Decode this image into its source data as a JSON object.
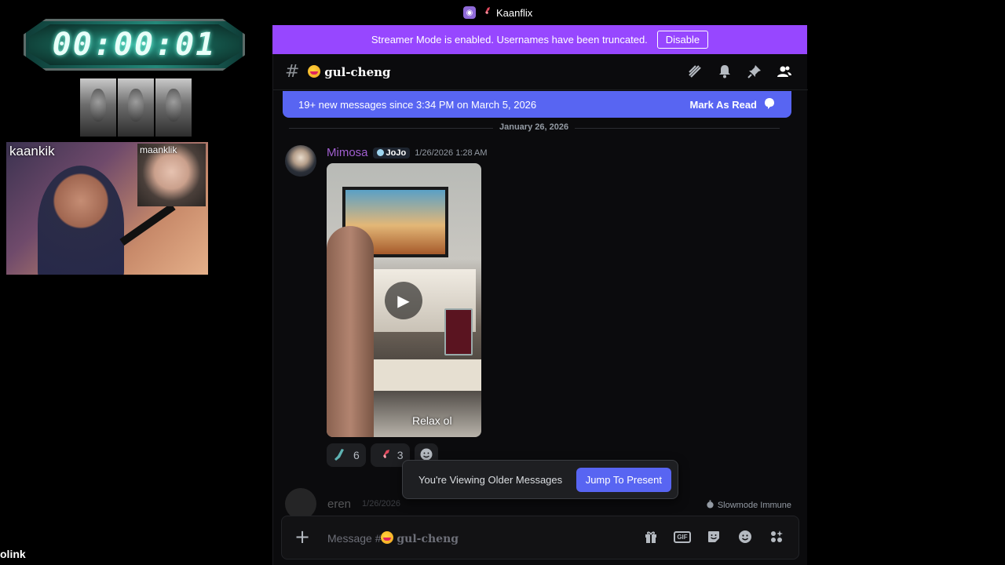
{
  "overlay": {
    "timer": "00:00:01",
    "cam_main_label": "kaankik",
    "cam_secondary_label": "maanklik",
    "bottom_left_text": "olink"
  },
  "window": {
    "title": "Kaanflix"
  },
  "streamer_banner": {
    "text": "Streamer Mode is enabled. Usernames have been truncated.",
    "button": "Disable"
  },
  "channel": {
    "name": "gul-cheng",
    "header_icons": [
      "threads-icon",
      "bell-icon",
      "pin-icon",
      "members-icon"
    ]
  },
  "new_messages_bar": {
    "text": "19+ new messages since 3:34 PM on March 5, 2026",
    "action": "Mark As Read"
  },
  "date_divider": "January 26, 2026",
  "message": {
    "author": "Mimosa",
    "role_tag": "JoJo",
    "timestamp": "1/26/2026 1:28 AM",
    "video_caption": "Relax ol",
    "reactions": [
      {
        "icon": "leg-icon",
        "count": "6"
      },
      {
        "icon": "rocket-icon",
        "count": "3"
      }
    ]
  },
  "next_message": {
    "author": "eren",
    "timestamp": "1/26/2026"
  },
  "older_toast": {
    "text": "You're Viewing Older Messages",
    "button": "Jump To Present"
  },
  "slowmode": "Slowmode Immune",
  "composer": {
    "placeholder_prefix": "Message #",
    "channel": "gul-cheng"
  },
  "colors": {
    "streamer_banner": "#9747ff",
    "accent": "#5865f2",
    "author": "#a15fd0"
  }
}
